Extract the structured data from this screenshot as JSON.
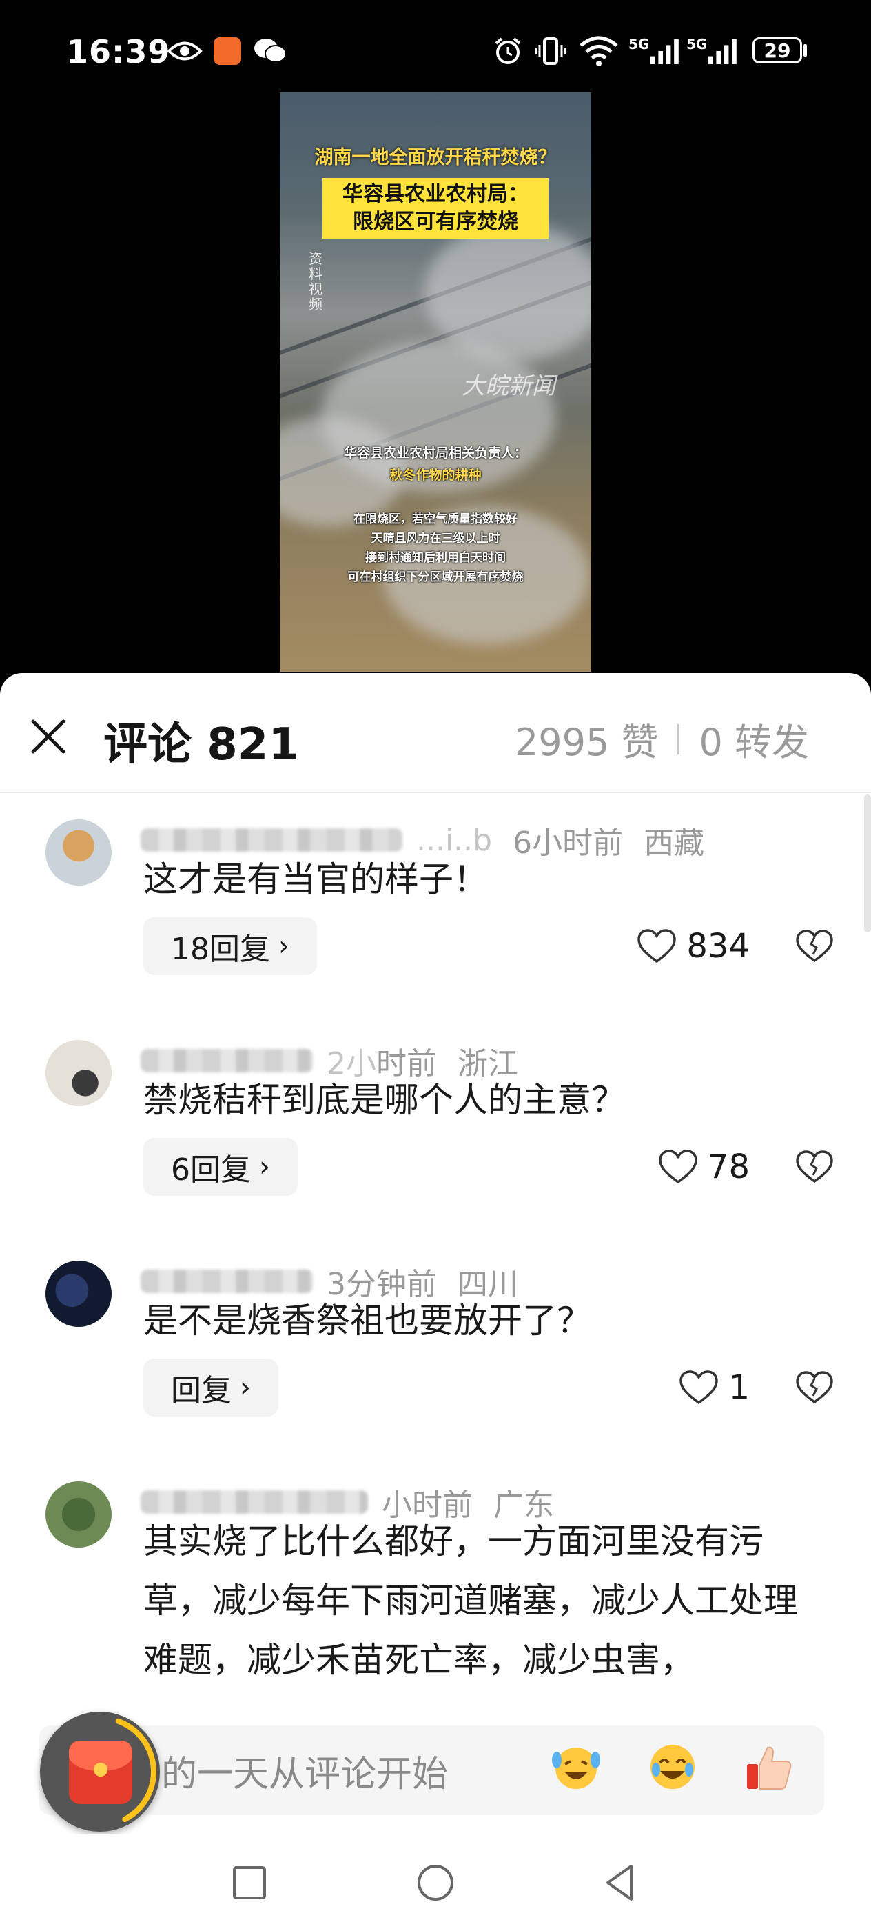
{
  "status_bar": {
    "time": "16:39",
    "icons": [
      "eye-icon",
      "app-icon",
      "wechat-icon",
      "alarm-icon",
      "vibrate-icon",
      "wifi-icon",
      "signal-5g-icon",
      "signal-5g-icon"
    ],
    "network_1": "5G",
    "network_2": "5G",
    "battery": "29"
  },
  "video": {
    "title_top": "湖南一地全面放开秸秆焚烧？",
    "title_box_line1": "华容县农业农村局：",
    "title_box_line2": "限烧区可有序焚烧",
    "side_label": "资料视频",
    "watermark": "大皖新闻",
    "caption_1": "华容县农业农村局相关负责人：",
    "caption_2": "秋冬作物的耕种",
    "caption_3": "在限烧区，若空气质量指数较好",
    "caption_4": "天晴且风力在三级以上时",
    "caption_5": "接到村通知后利用白天时间",
    "caption_6": "可在村组织下分区域开展有序焚烧"
  },
  "sheet": {
    "title": "评论 821",
    "likes_total": "2995 赞",
    "shares": "0 转发"
  },
  "comments": [
    {
      "name_tail": "...i..b",
      "time": "6小时前",
      "location": "西藏",
      "text": "这才是有当官的样子！",
      "replies": "18回复",
      "likes": "834"
    },
    {
      "name_tail": "2小",
      "time": "时前",
      "location": "浙江",
      "text": "禁烧秸秆到底是哪个人的主意？",
      "replies": "6回复",
      "likes": "78"
    },
    {
      "name_tail": "",
      "time": "3分钟前",
      "location": "四川",
      "text": "是不是烧香祭祖也要放开了？",
      "replies": "回复",
      "likes": "1"
    },
    {
      "name_tail": "",
      "time": "小时前",
      "location": "广东",
      "text": "其实烧了比什么都好，一方面河里没有污草，减少每年下雨河道赌塞，减少人工处理难题，减少禾苗死亡率，减少虫害，"
    }
  ],
  "input": {
    "placeholder": "美好的一天从评论开始",
    "emojis": [
      "laughing-crying-emoji",
      "tears-of-joy-emoji",
      "thumbs-up-emoji"
    ]
  },
  "colors": {
    "accent_red": "#e33c2c",
    "muted_text": "#9a9a9a",
    "video_yellow": "#ffd84a"
  }
}
